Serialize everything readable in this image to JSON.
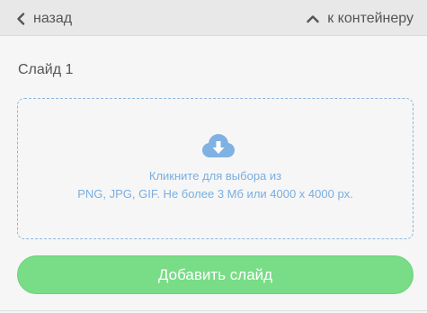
{
  "nav": {
    "back_label": "назад",
    "back_icon": "chevron-left-icon",
    "up_label": "к контейнеру",
    "up_icon": "chevron-up-icon"
  },
  "slide": {
    "title": "Слайд 1"
  },
  "upload": {
    "icon": "cloud-download-icon",
    "line1": "Кликните для выбора из",
    "line2": "PNG, JPG, GIF. Не более 3 Мб или 4000 x 4000 px."
  },
  "actions": {
    "add_slide_label": "Добавить слайд"
  },
  "colors": {
    "topbar_bg": "#e8e8e8",
    "page_bg": "#f6f6f6",
    "accent_blue": "#7aaee0",
    "button_green": "#79dc87"
  }
}
